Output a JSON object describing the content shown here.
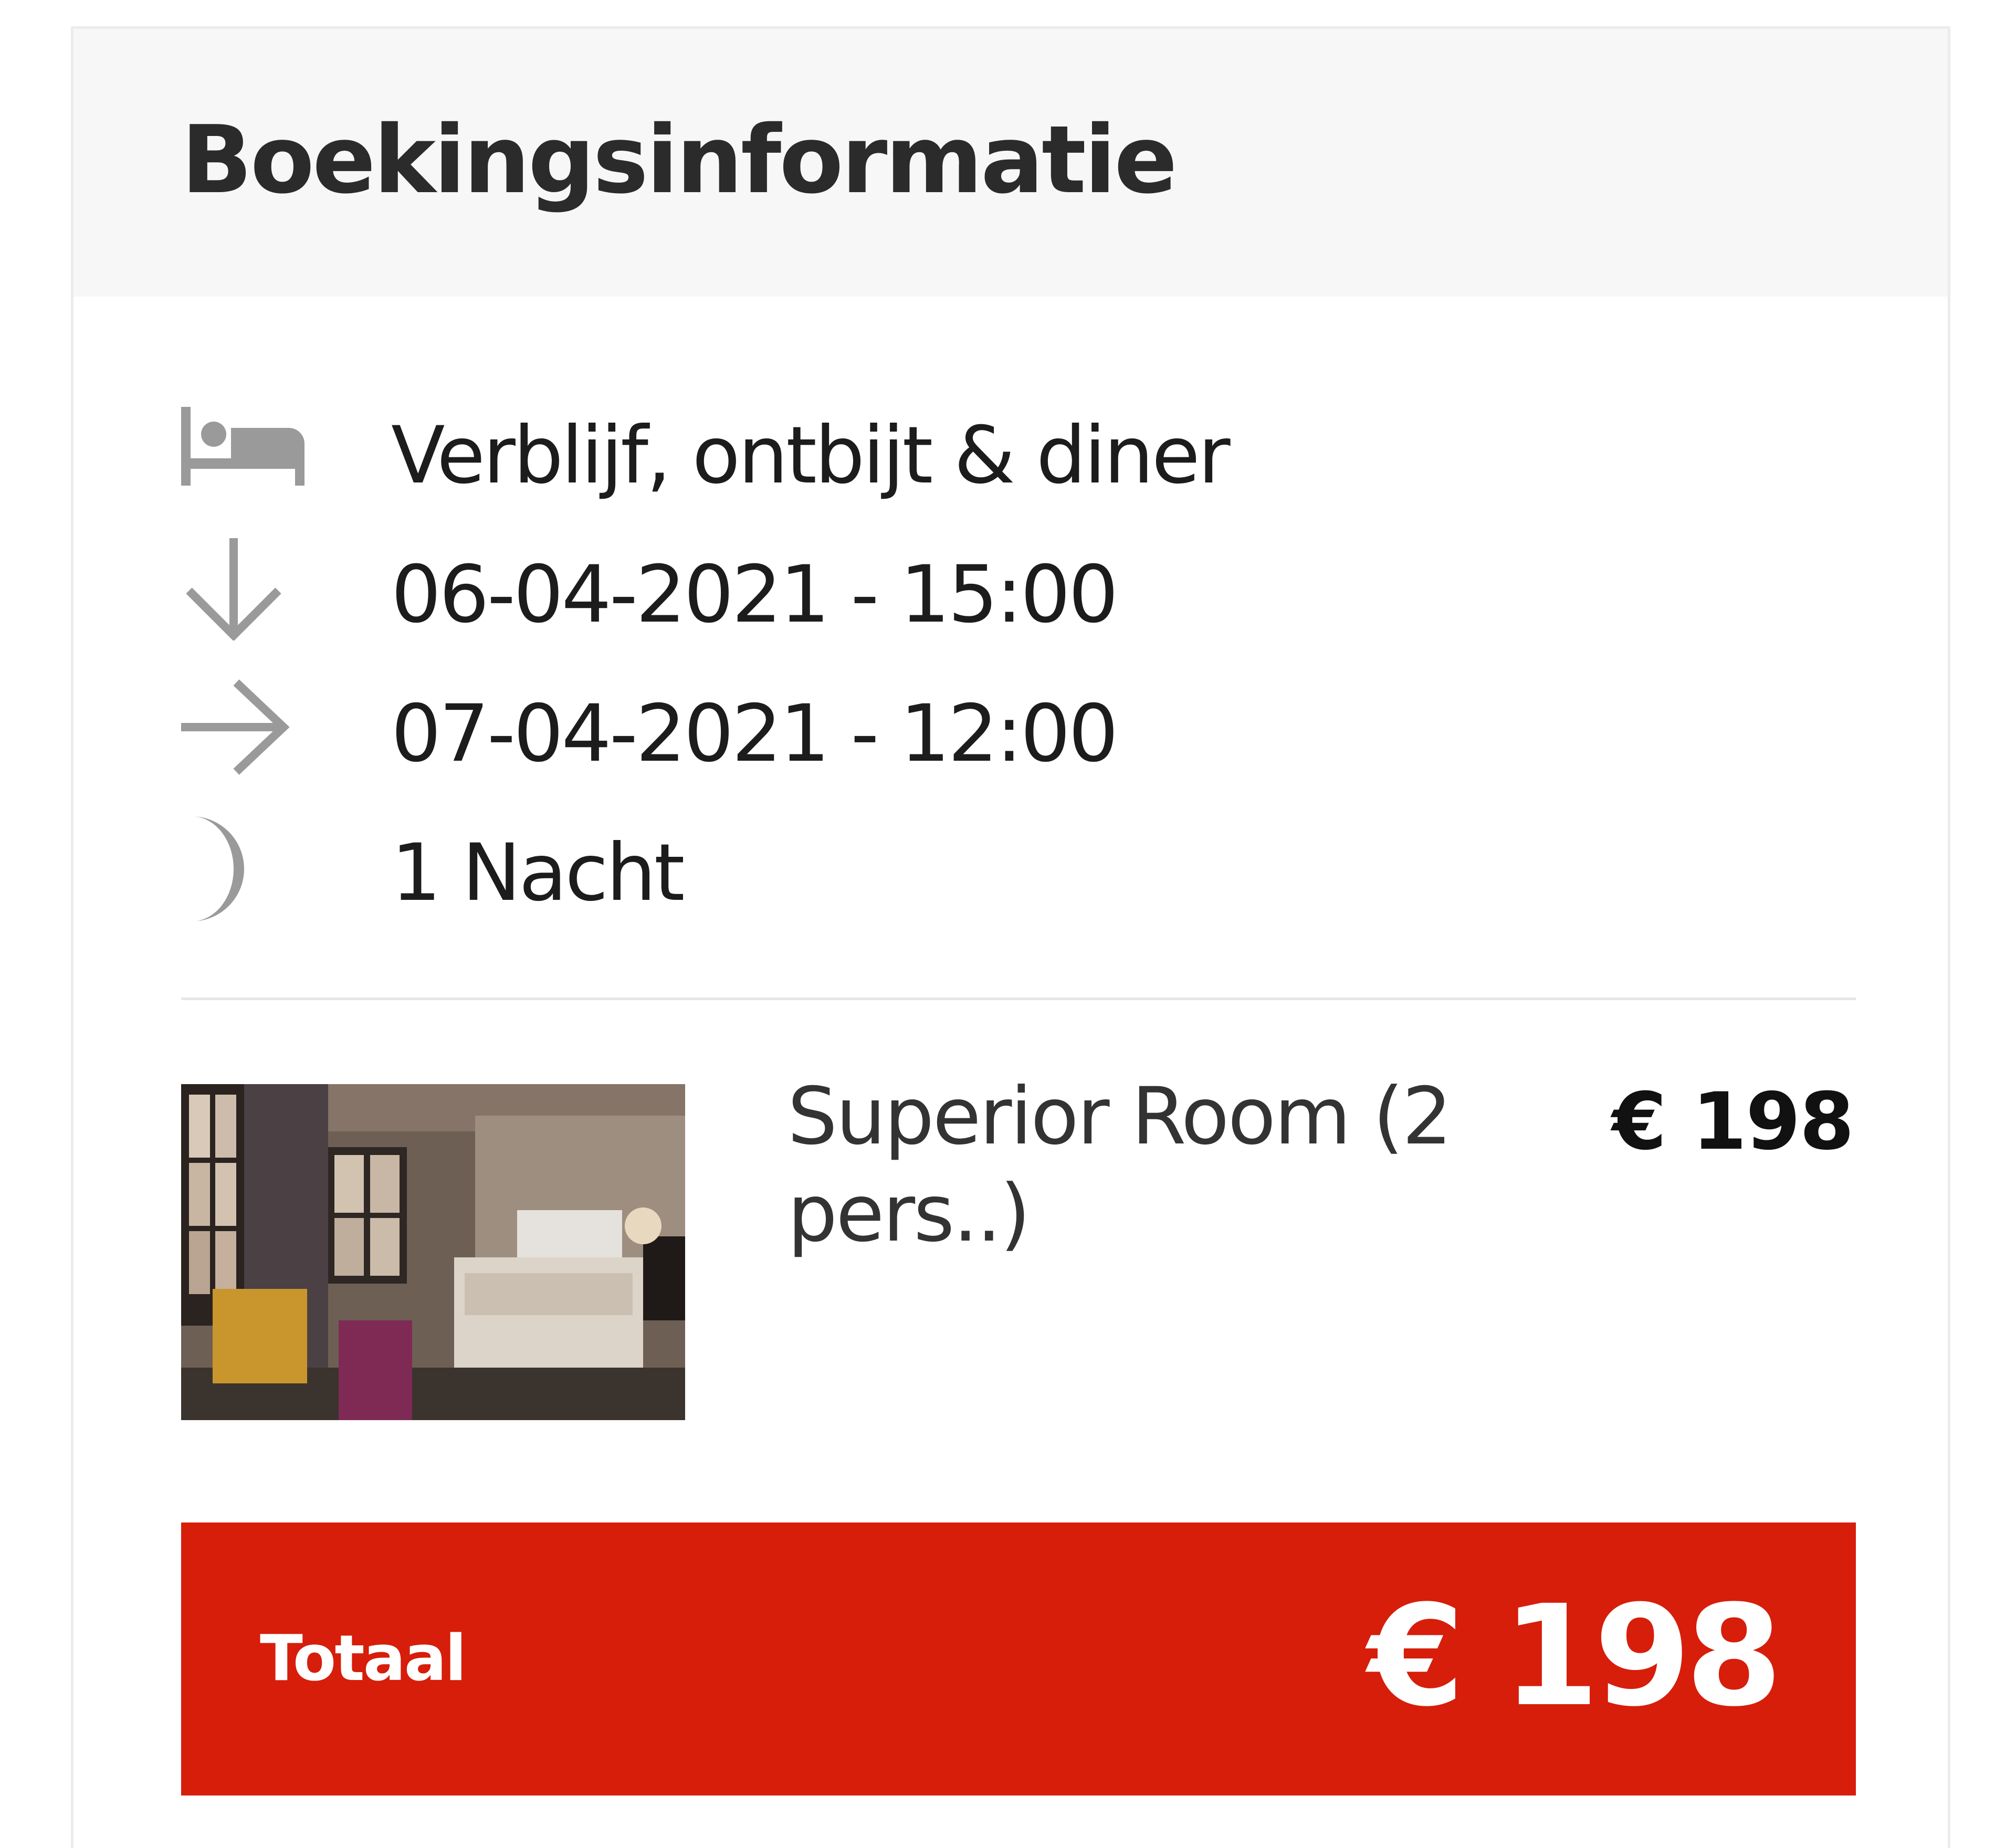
{
  "booking": {
    "title": "Boekingsinformatie",
    "details": [
      {
        "icon": "bed-icon",
        "text": "Verblijf, ontbijt & diner"
      },
      {
        "icon": "arrow-down-icon",
        "text": "06-04-2021 - 15:00"
      },
      {
        "icon": "arrow-right-icon",
        "text": "07-04-2021 - 12:00"
      },
      {
        "icon": "moon-icon",
        "text": "1 Nacht"
      }
    ],
    "room": {
      "name": "Superior Room (2 pers..)",
      "price": "€ 198"
    },
    "total": {
      "label": "Totaal",
      "amount": "€ 198"
    }
  },
  "colors": {
    "accent": "#d61e0b",
    "header_bg": "#f7f7f7",
    "icon": "#9a9a9a"
  }
}
